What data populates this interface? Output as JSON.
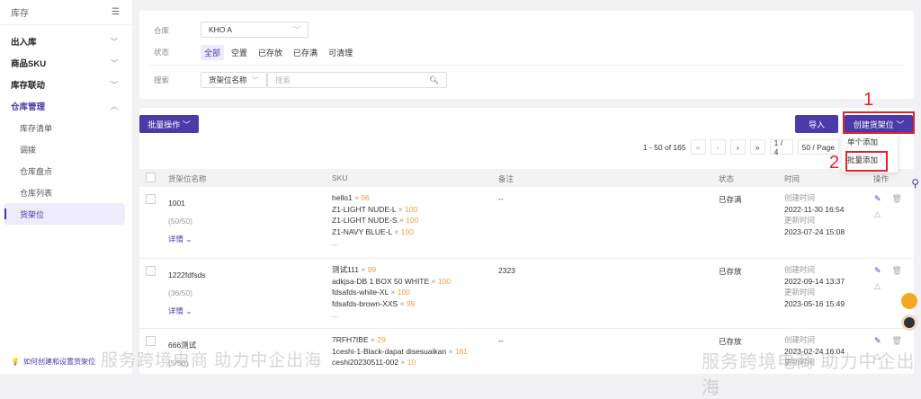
{
  "sidebar": {
    "title": "库存",
    "items": [
      {
        "label": "出入库"
      },
      {
        "label": "商品SKU"
      },
      {
        "label": "库存联动"
      },
      {
        "label": "仓库管理"
      }
    ],
    "sub_items": [
      {
        "label": "库存清单"
      },
      {
        "label": "调拨"
      },
      {
        "label": "仓库盘点"
      },
      {
        "label": "仓库列表"
      },
      {
        "label": "货架位"
      }
    ],
    "help": "如何创建和设置货架位"
  },
  "filter": {
    "warehouse_label": "仓库",
    "warehouse_value": "KHO A",
    "status_label": "状态",
    "status_options": [
      "全部",
      "空置",
      "已存放",
      "已存满",
      "可清理"
    ],
    "search_label": "搜索",
    "search_field": "货架位名称",
    "search_placeholder": "搜索"
  },
  "toolbar": {
    "bulk": "批量操作",
    "import": "导入",
    "create": "创建货架位",
    "dropdown": [
      "单个添加",
      "批量添加"
    ],
    "annotations": [
      "1",
      "2"
    ]
  },
  "pager": {
    "range": "1 - 50 of 165",
    "first": "«",
    "prev": "‹",
    "next": "›",
    "last": "»",
    "page": "1 / 4",
    "per_page": "50 / Page"
  },
  "table": {
    "headers": [
      "货架位名称",
      "SKU",
      "备注",
      "状态",
      "时间",
      "操作"
    ],
    "created_label": "创建时间",
    "updated_label": "更新时间",
    "detail": "详情",
    "rows": [
      {
        "name": "1001",
        "count": "(50/50)",
        "skus": [
          {
            "n": "hello1",
            "q": "96"
          },
          {
            "n": "Z1-LIGHT NUDE-L",
            "q": "100"
          },
          {
            "n": "Z1-LIGHT NUDE-S",
            "q": "100"
          },
          {
            "n": "Z1-NAVY BLUE-L",
            "q": "100"
          }
        ],
        "more": "...",
        "note": "--",
        "status": "已存满",
        "created": "2022-11-30 16:54",
        "updated": "2023-07-24 15:08"
      },
      {
        "name": "1222fdfsds",
        "count": "(36/50)",
        "skus": [
          {
            "n": "测试111",
            "q": "99"
          },
          {
            "n": "adkjsa-DB 1 BOX 50 WHITE",
            "q": "100"
          },
          {
            "n": "fdsafds-white-XL",
            "q": "100"
          },
          {
            "n": "fdsafds-brown-XXS",
            "q": "99"
          }
        ],
        "more": "...",
        "note": "2323",
        "status": "已存放",
        "created": "2022-09-14 13:37",
        "updated": "2023-05-16 15:49"
      },
      {
        "name": "666测试",
        "count": "(5/50)",
        "skus": [
          {
            "n": "7RFH7IBE",
            "q": "29"
          },
          {
            "n": "1ceshi-1-Black-dapat disesuaikan",
            "q": "181"
          },
          {
            "n": "ceshi20230511-002",
            "q": "10"
          }
        ],
        "note": "--",
        "status": "已存放",
        "created": "2023-02-24 16:04",
        "updated": ""
      }
    ]
  },
  "watermark": "服务跨境电商 助力中企出海",
  "colors": {
    "accent": "#4b3aa7",
    "qty": "#f0a040",
    "annotation": "#e0232d"
  }
}
